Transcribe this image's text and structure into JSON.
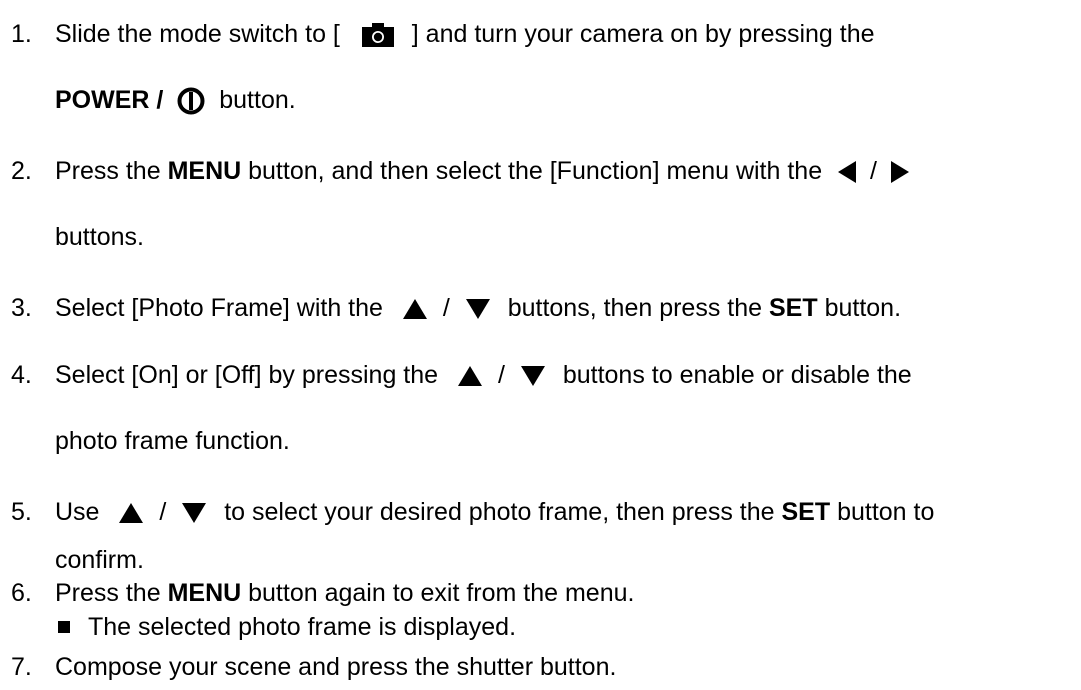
{
  "steps": [
    {
      "num": "1.",
      "t1": "Slide the mode switch to [",
      "t2": "] and turn your camera on by pressing the",
      "t3": "POWER /",
      "t4": "button."
    },
    {
      "num": "2.",
      "t1": "Press the",
      "b1": "MENU",
      "t2": "button, and then select the [Function] menu with the",
      "t3": "/",
      "t4": "buttons."
    },
    {
      "num": "3.",
      "t1": "Select [Photo Frame] with the",
      "t2": "/",
      "t3": "buttons, then press the",
      "b1": "SET",
      "t4": "button."
    },
    {
      "num": "4.",
      "t1": "Select [On] or [Off] by pressing the",
      "t2": "/",
      "t3": "buttons to enable or disable the",
      "t4": "photo frame function."
    },
    {
      "num": "5.",
      "t1": "Use",
      "t2": "/",
      "t3": "to select your desired photo frame, then press the",
      "b1": "SET",
      "t4": "button to",
      "t5": "confirm."
    },
    {
      "num": "6.",
      "t1": "Press the",
      "b1": "MENU",
      "t2": "button again to exit from the menu.",
      "sub": "The selected photo frame is displayed."
    },
    {
      "num": "7.",
      "t1": "Compose your scene and press the shutter button."
    }
  ],
  "icons": {
    "camera": "camera-icon",
    "power": "power-icon",
    "left": "left-arrow-icon",
    "right": "right-arrow-icon",
    "up": "up-arrow-icon",
    "down": "down-arrow-icon"
  }
}
